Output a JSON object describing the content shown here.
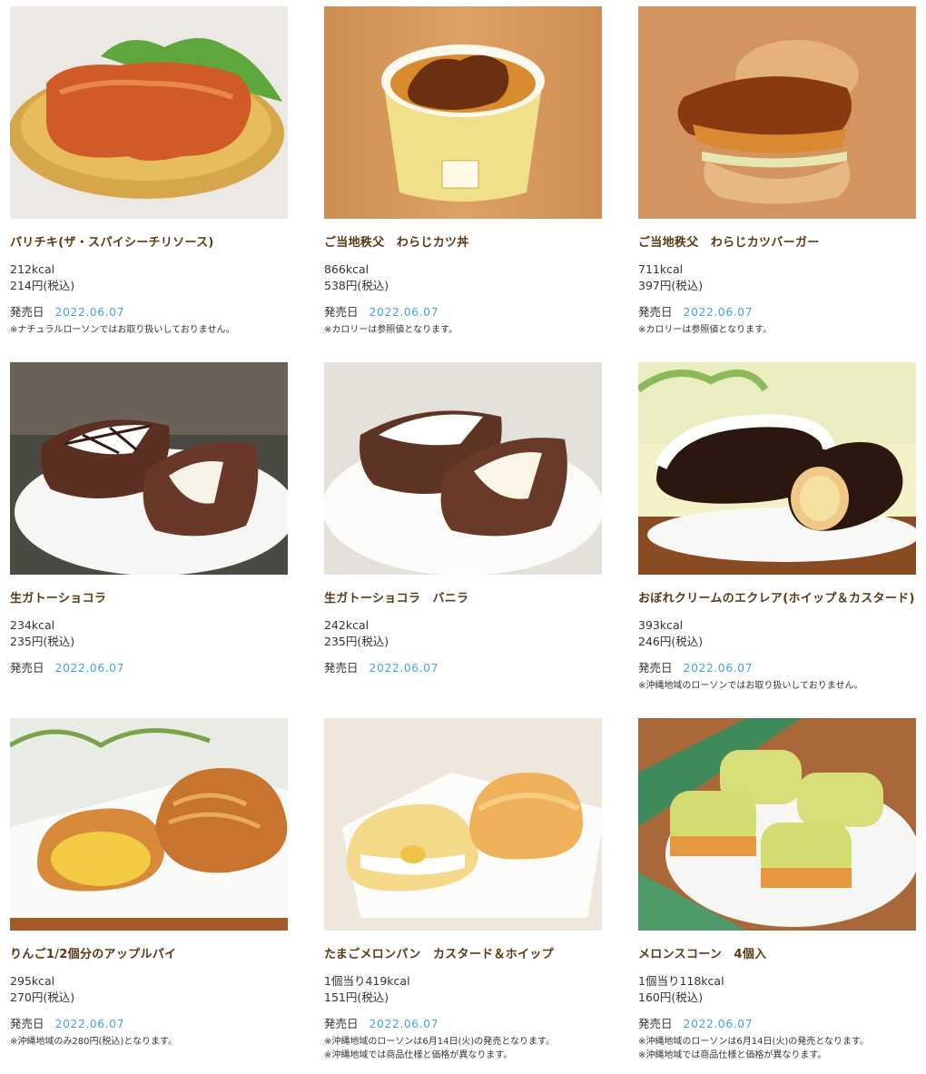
{
  "products": [
    {
      "name": "パリチキ(ザ・スパイシーチリソース)",
      "kcal": "212kcal",
      "price": "214円(税込)",
      "release_label": "発売日",
      "release_date": "2022.06.07",
      "notes": [
        "※ナチュラルローソンではお取り扱いしておりません。"
      ],
      "image": "spicy-fried-chicken-photo"
    },
    {
      "name": "ご当地秩父　わらじカツ丼",
      "kcal": "866kcal",
      "price": "538円(税込)",
      "release_label": "発売日",
      "release_date": "2022.06.07",
      "notes": [
        "※カロリーは参照値となります。"
      ],
      "image": "katsu-don-bowl-photo"
    },
    {
      "name": "ご当地秩父　わらじカツバーガー",
      "kcal": "711kcal",
      "price": "397円(税込)",
      "release_label": "発売日",
      "release_date": "2022.06.07",
      "notes": [
        "※カロリーは参照値となります。"
      ],
      "image": "katsu-burger-photo"
    },
    {
      "name": "生ガトーショコラ",
      "kcal": "234kcal",
      "price": "235円(税込)",
      "release_label": "発売日",
      "release_date": "2022.06.07",
      "notes": [],
      "image": "gateau-chocolat-photo"
    },
    {
      "name": "生ガトーショコラ　バニラ",
      "kcal": "242kcal",
      "price": "235円(税込)",
      "release_label": "発売日",
      "release_date": "2022.06.07",
      "notes": [],
      "image": "gateau-chocolat-vanilla-photo"
    },
    {
      "name": "おぼれクリームのエクレア(ホイップ＆カスタード)",
      "kcal": "393kcal",
      "price": "246円(税込)",
      "release_label": "発売日",
      "release_date": "2022.06.07",
      "notes": [
        "※沖縄地域のローソンではお取り扱いしておりません。"
      ],
      "image": "eclair-photo"
    },
    {
      "name": "りんご1/2個分のアップルパイ",
      "kcal": "295kcal",
      "price": "270円(税込)",
      "release_label": "発売日",
      "release_date": "2022.06.07",
      "notes": [
        "※沖縄地域のみ280円(税込)となります。"
      ],
      "image": "apple-pie-photo"
    },
    {
      "name": "たまごメロンパン　カスタード＆ホイップ",
      "kcal": "1個当り419kcal",
      "price": "151円(税込)",
      "release_label": "発売日",
      "release_date": "2022.06.07",
      "notes": [
        "※沖縄地域のローソンは6月14日(火)の発売となります。",
        "※沖縄地域では商品仕様と価格が異なります。"
      ],
      "image": "melon-pan-photo"
    },
    {
      "name": "メロンスコーン　4個入",
      "kcal": "1個当り118kcal",
      "price": "160円(税込)",
      "release_label": "発売日",
      "release_date": "2022.06.07",
      "notes": [
        "※沖縄地域のローソンは6月14日(火)の発売となります。",
        "※沖縄地域では商品仕様と価格が異なります。"
      ],
      "image": "melon-scone-photo"
    }
  ],
  "colors": {
    "name_text": "#5a3a14",
    "date_text": "#4aa3d8",
    "body_text": "#333333"
  }
}
